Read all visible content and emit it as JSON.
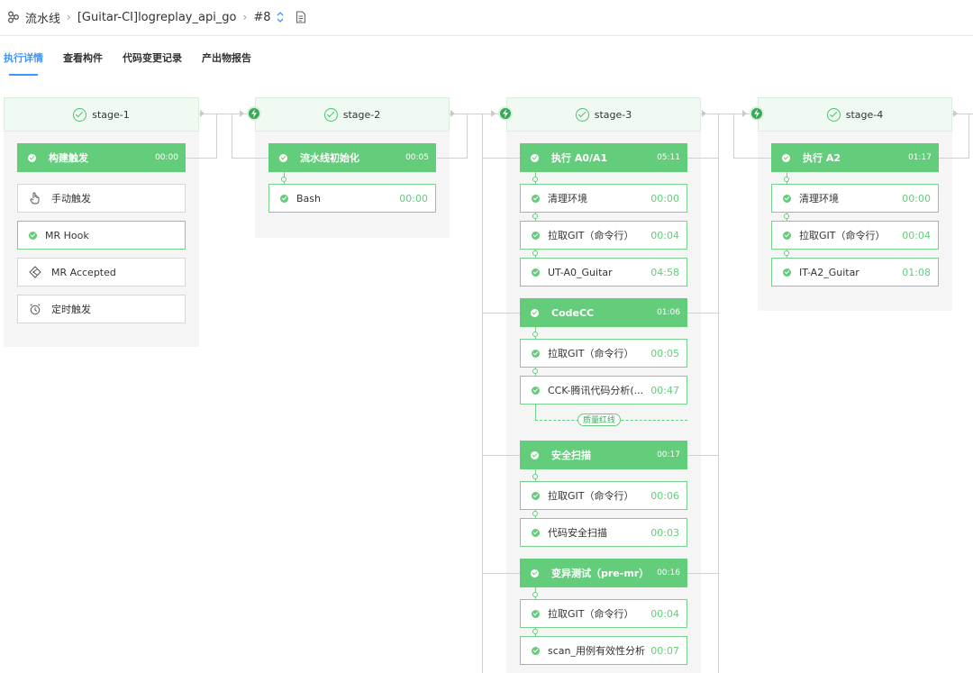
{
  "breadcrumb": {
    "root": "流水线",
    "pipeline": "[Guitar-CI]logreplay_api_go",
    "build": "#8"
  },
  "tabs": [
    {
      "label": "执行详情",
      "active": true
    },
    {
      "label": "查看构件"
    },
    {
      "label": "代码变更记录"
    },
    {
      "label": "产出物报告"
    }
  ],
  "quality_gate": "质量红线",
  "stages": [
    {
      "name": "stage-1",
      "jobs": [
        {
          "name": "构建触发",
          "time": "00:00",
          "steps": [
            {
              "name": "手动触发",
              "icon": "hand-icon"
            },
            {
              "name": "MR Hook",
              "icon": "check-icon"
            },
            {
              "name": "MR Accepted",
              "icon": "merge-icon"
            },
            {
              "name": "定时触发",
              "icon": "alarm-icon"
            }
          ]
        }
      ]
    },
    {
      "name": "stage-2",
      "jobs": [
        {
          "name": "流水线初始化",
          "time": "00:05",
          "steps": [
            {
              "name": "Bash",
              "time": "00:00"
            }
          ]
        }
      ]
    },
    {
      "name": "stage-3",
      "jobs": [
        {
          "name": "执行 A0/A1",
          "time": "05:11",
          "steps": [
            {
              "name": "清理环境",
              "time": "00:00"
            },
            {
              "name": "拉取GIT（命令行）",
              "time": "00:04"
            },
            {
              "name": "UT-A0_Guitar",
              "time": "04:58"
            }
          ]
        },
        {
          "name": "CodeCC",
          "time": "01:06",
          "steps": [
            {
              "name": "拉取GIT（命令行）",
              "time": "00:05"
            },
            {
              "name": "CCK-腾讯代码分析(...",
              "time": "00:47"
            }
          ]
        },
        {
          "name": "安全扫描",
          "time": "00:17",
          "steps": [
            {
              "name": "拉取GIT（命令行）",
              "time": "00:06"
            },
            {
              "name": "代码安全扫描",
              "time": "00:03"
            }
          ]
        },
        {
          "name": "变异测试（pre-mr）",
          "time": "00:16",
          "steps": [
            {
              "name": "拉取GIT（命令行）",
              "time": "00:04"
            },
            {
              "name": "scan_用例有效性分析",
              "time": "00:07"
            }
          ]
        }
      ]
    },
    {
      "name": "stage-4",
      "jobs": [
        {
          "name": "执行 A2",
          "time": "01:17",
          "steps": [
            {
              "name": "清理环境",
              "time": "00:00"
            },
            {
              "name": "拉取GIT（命令行）",
              "time": "00:04"
            },
            {
              "name": "IT-A2_Guitar",
              "time": "01:08"
            }
          ]
        }
      ]
    }
  ]
}
